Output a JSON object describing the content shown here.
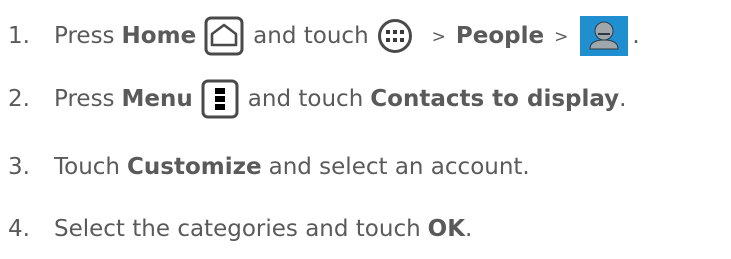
{
  "steps": [
    {
      "number": "1.",
      "press": "Press",
      "home": "Home",
      "and_touch": "and touch",
      "sep1": ">",
      "people": "People",
      "sep2": ">",
      "end": ".",
      "icons": [
        "home-button-icon",
        "all-apps-icon",
        "contacts-tab-icon"
      ]
    },
    {
      "number": "2.",
      "press": "Press",
      "menu": "Menu",
      "and_touch": "and touch",
      "contacts_to_display": "Contacts to display",
      "end": ".",
      "icons": [
        "menu-button-icon"
      ]
    },
    {
      "number": "3.",
      "touch": "Touch",
      "customize": "Customize",
      "rest": "and select an account."
    },
    {
      "number": "4.",
      "select": "Select the categories and touch",
      "ok": "OK",
      "end": "."
    }
  ],
  "colors": {
    "text": "#5a5a5a",
    "icon_outline": "#4a4a4a",
    "contacts_tab_bg": "#1f8fd0",
    "contacts_tab_fg": "#9fa7ad"
  }
}
